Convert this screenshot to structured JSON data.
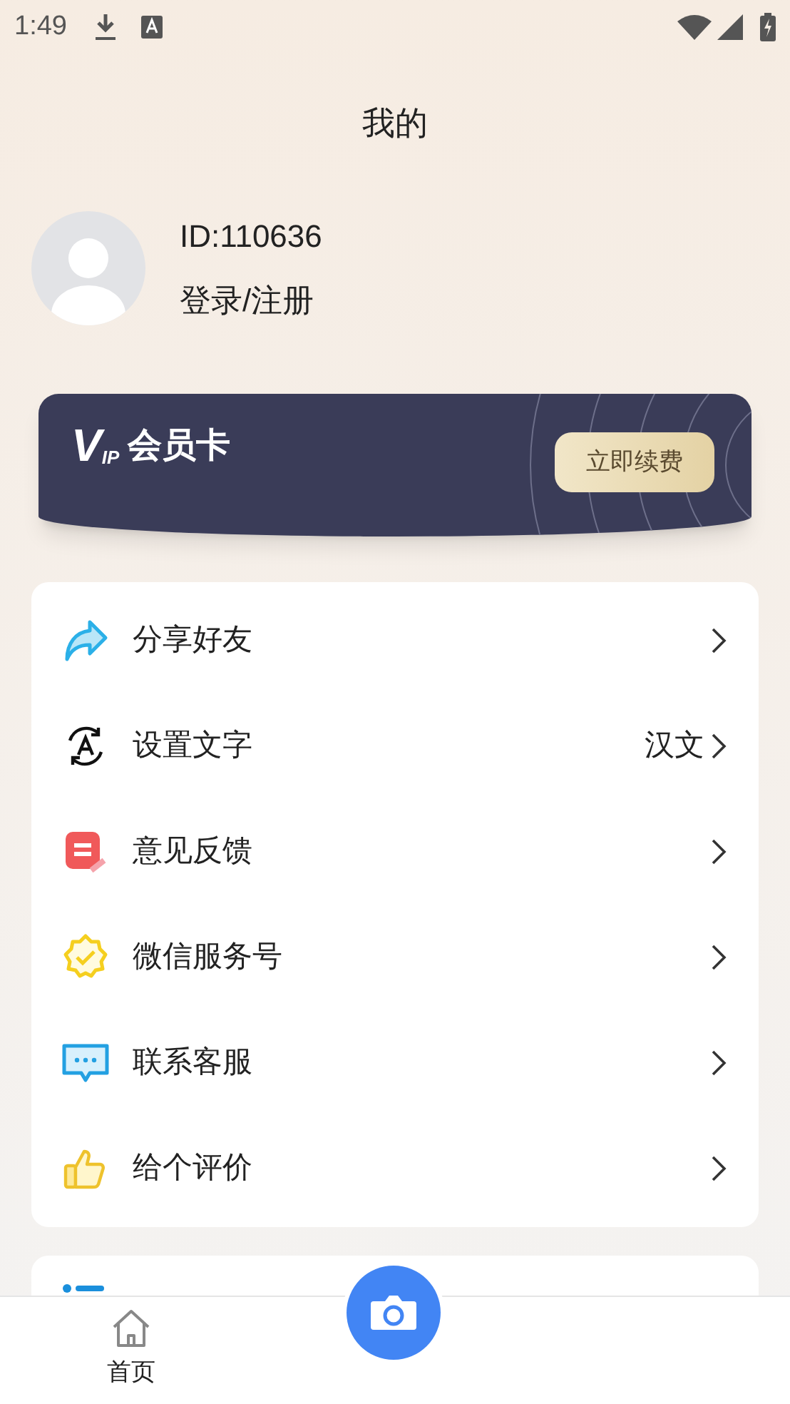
{
  "status_bar": {
    "time": "1:49"
  },
  "title": "我的",
  "profile": {
    "id": "ID:110636",
    "login": "登录/注册"
  },
  "vip_card": {
    "logo_big": "V",
    "logo_small": "IP",
    "label": "会员卡",
    "button": "立即续费"
  },
  "menu": [
    {
      "kind": "share",
      "label": "分享好友"
    },
    {
      "kind": "text",
      "label": "设置文字",
      "value": "汉文"
    },
    {
      "kind": "feedback",
      "label": "意见反馈"
    },
    {
      "kind": "wechat",
      "label": "微信服务号"
    },
    {
      "kind": "service",
      "label": "联系客服"
    },
    {
      "kind": "rate",
      "label": "给个评价"
    }
  ],
  "more": {
    "kind": "list"
  },
  "bottom_nav": [
    {
      "kind": "home",
      "label": "首页",
      "selected": false
    },
    {
      "kind": "camera"
    }
  ]
}
